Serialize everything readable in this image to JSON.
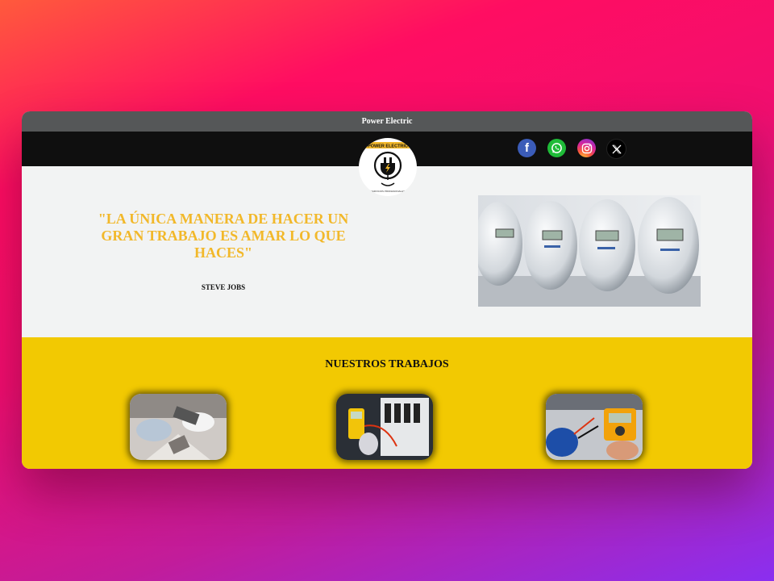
{
  "window": {
    "title": "Power Electric"
  },
  "navbar": {
    "logo": {
      "icon": "plug-lightning-logo",
      "brand_text": "POWER ELECTRIC",
      "tagline": "SERVICIOS PROFESIONALES"
    },
    "social": [
      {
        "name": "facebook-icon",
        "glyph": "f"
      },
      {
        "name": "whatsapp-icon",
        "glyph": ""
      },
      {
        "name": "instagram-icon",
        "glyph": ""
      },
      {
        "name": "x-icon",
        "glyph": "𝕏"
      }
    ]
  },
  "hero": {
    "quote": "\"LA ÚNICA MANERA DE HACER UN GRAN TRABAJO ES AMAR LO QUE HACES\"",
    "author": "STEVE JOBS",
    "image": "electric-meters-photo"
  },
  "works": {
    "title": "NUESTROS TRABAJOS",
    "items": [
      {
        "image": "electrician-gloves-photo"
      },
      {
        "image": "multimeter-panel-photo"
      },
      {
        "image": "multimeter-testing-photo"
      }
    ]
  },
  "colors": {
    "accent": "#f2b82a",
    "works_bg": "#f2c902",
    "titlebar": "#555758",
    "navbar": "#0f0f0f"
  }
}
